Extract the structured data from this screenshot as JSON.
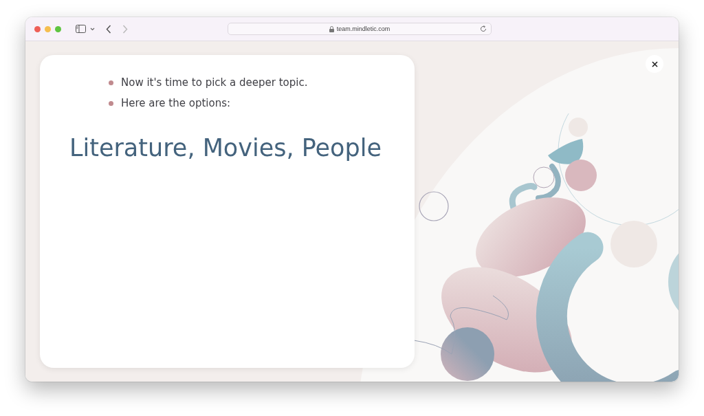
{
  "browser": {
    "url": "team.mindletic.com",
    "back_disabled": false,
    "forward_disabled": true
  },
  "bullets": [
    {
      "text": "Now it's time to pick a deeper topic."
    },
    {
      "text": "Here are the options:"
    }
  ],
  "heading": "Literature, Movies, People"
}
